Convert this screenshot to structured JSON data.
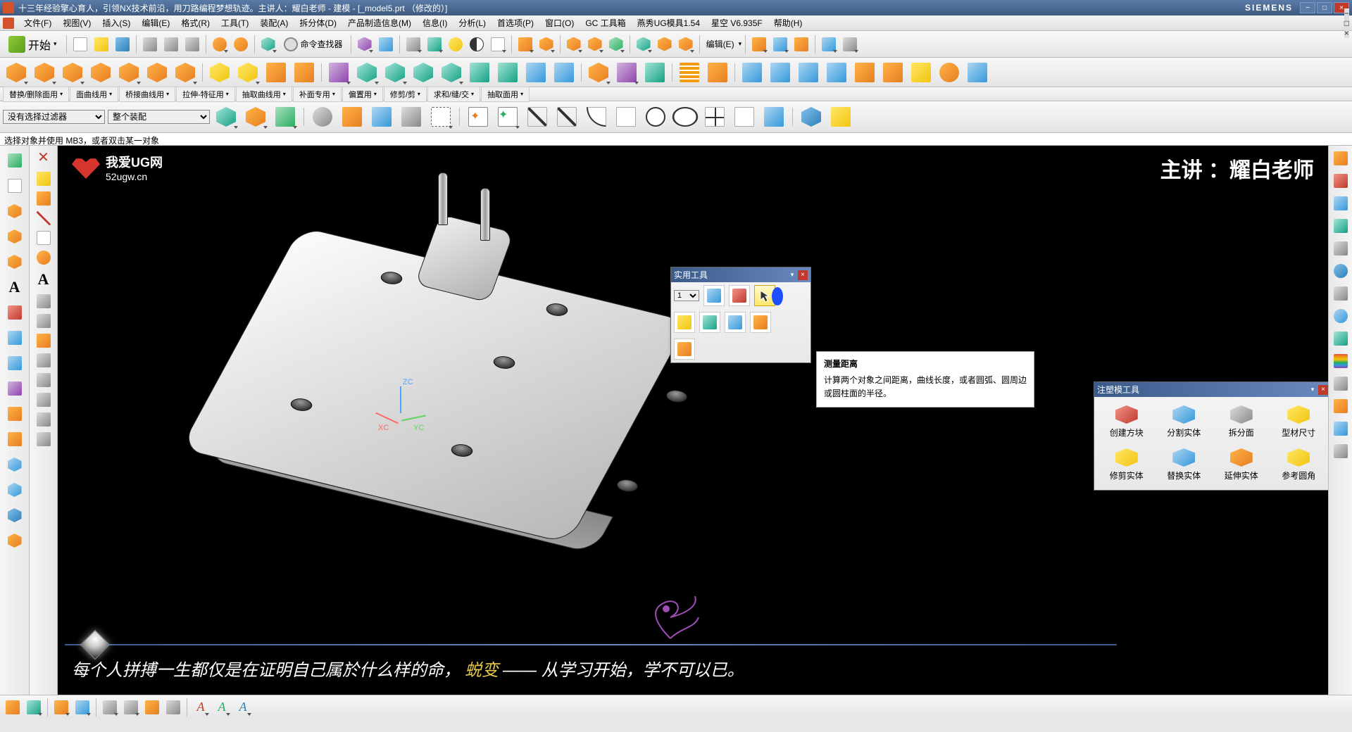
{
  "title_prefix": "十三年经验擎心育人，引领NX技术前沿，用刀路编程梦想轨迹。主讲人：耀白老师 - 建模 - [_model5.prt （修改的）]",
  "brand": "SIEMENS",
  "menu": {
    "file": "文件(F)",
    "view": "视图(V)",
    "insert": "插入(S)",
    "edit": "编辑(E)",
    "format": "格式(R)",
    "tools": "工具(T)",
    "assemblies": "装配(A)",
    "sheet": "拆分体(D)",
    "pmi": "产品制造信息(M)",
    "info": "信息(I)",
    "analysis": "分析(L)",
    "preference": "首选项(P)",
    "window": "窗口(O)",
    "gc": "GC 工具箱",
    "hx": "燕秀UG模具1.54",
    "xq": "星空 V6.935F",
    "help": "帮助(H)"
  },
  "start_label": "开始",
  "cmd_finder": "命令查找器",
  "sub_tabs": {
    "t1": "替换/删除面用",
    "t2": "面曲线用",
    "t3": "桥接曲线用",
    "t4": "拉伸-特征用",
    "t5": "抽取曲线用",
    "t6": "补面专用",
    "t7": "偏置用",
    "t8": "修剪/剪",
    "t9": "求和/缝/交",
    "t10": "抽取面用"
  },
  "filter": {
    "sel1": "没有选择过滤器",
    "sel2": "整个装配"
  },
  "status": "选择对象并使用 MB3，或者双击某一对象",
  "logo": {
    "main": "我爱UG网",
    "sub": "52ugw.cn"
  },
  "teacher": "主讲 ：耀白老师",
  "triad": {
    "z": "ZC",
    "x": "XC",
    "y": "YC"
  },
  "util_panel": {
    "title": "实用工具",
    "layer_val": "1"
  },
  "tooltip": {
    "title": "测量距离",
    "body": "计算两个对象之间距离，曲线长度，或者圆弧、圆周边或圆柱面的半径。"
  },
  "mold_panel": {
    "title": "注塑模工具",
    "items": [
      {
        "label": "创建方块",
        "c": "sw-red"
      },
      {
        "label": "分割实体",
        "c": "sw-cyan"
      },
      {
        "label": "拆分面",
        "c": "sw-gray"
      },
      {
        "label": "型材尺寸",
        "c": "sw-yellow"
      },
      {
        "label": "修剪实体",
        "c": "sw-yellow"
      },
      {
        "label": "替换实体",
        "c": "sw-cyan"
      },
      {
        "label": "延伸实体",
        "c": "sw-orange"
      },
      {
        "label": "参考圆角",
        "c": "sw-yellow"
      }
    ]
  },
  "quote": {
    "p1": "每个人拼搏一生都仅是在证明自己属於什么样的命，",
    "hl": "蜕变",
    "p2": " —— 从学习开始，学不可以已。"
  },
  "edit_dd": "编辑(E)"
}
